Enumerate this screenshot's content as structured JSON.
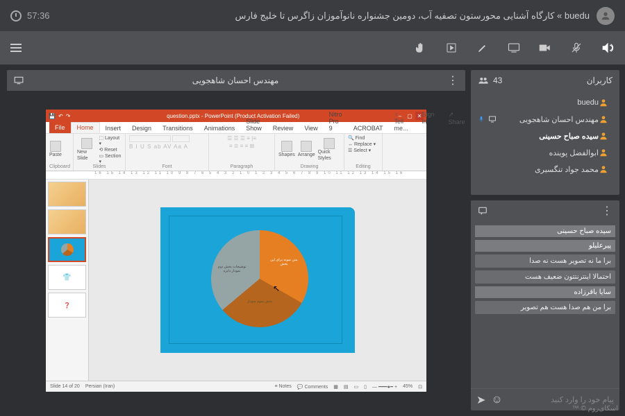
{
  "header": {
    "title": "buedu » کارگاه آشنایی محورستون تصفیه آب، دومین جشنواره نانوآموزان زاگرس تا خلیج فارس",
    "timer": "57:36"
  },
  "presentation": {
    "presenter_name": "مهندس احسان شاهجویی"
  },
  "users": {
    "panel_title": "کاربران",
    "count": "43",
    "list": [
      {
        "name": "buedu",
        "bold": false
      },
      {
        "name": "مهندس احسان شاهجویی",
        "bold": false,
        "mic": true,
        "screen": true
      },
      {
        "name": "سیده صباح حسینی",
        "bold": true
      },
      {
        "name": "ابوالفضل پوینده",
        "bold": false
      },
      {
        "name": "محمد جواد تنگسیری",
        "bold": false
      }
    ]
  },
  "chat": {
    "messages": [
      {
        "name": "سیده صباح حسینی",
        "text": ""
      },
      {
        "name": "پیرعلیلو",
        "text": "برا ما نه تصویر هست نه صدا"
      },
      {
        "name": "",
        "text": "احتمالا اینترنتتون ضعیف هست"
      },
      {
        "name": "سایا باقرزاده",
        "text": "برا من هم صدا هست هم تصویر"
      }
    ],
    "placeholder": "پیام خود را وارد کنید"
  },
  "powerpoint": {
    "title": "question.pptx - PowerPoint (Product Activation Failed)",
    "tabs": [
      "File",
      "Home",
      "Insert",
      "Design",
      "Transitions",
      "Animations",
      "Slide Show",
      "Review",
      "View",
      "Nitro Pro 9",
      "ACROBAT"
    ],
    "tell_me": "♀ Tell me...",
    "sign_in": "Sign in",
    "share": "↗ Share",
    "groups": {
      "clipboard": "Clipboard",
      "slides": "Slides",
      "font": "Font",
      "paragraph": "Paragraph",
      "drawing": "Drawing",
      "editing": "Editing",
      "paste": "Paste",
      "new_slide": "New Slide",
      "layout": "⬚ Layout ▾",
      "reset": "⟲ Reset",
      "section": "▭ Section ▾",
      "shapes": "Shapes",
      "arrange": "Arrange",
      "quick_styles": "Quick Styles",
      "find": "🔍 Find",
      "replace": "↔ Replace ▾",
      "select": "☰ Select ▾"
    },
    "status_left": "Slide 14 of 20",
    "status_lang": "Persian (Iran)",
    "status_notes": "≡ Notes",
    "status_comments": "💬 Comments",
    "zoom": "45%"
  },
  "chart_data": {
    "type": "pie",
    "title": "",
    "series": [
      {
        "name": "slice-orange",
        "value": 33,
        "color": "#e67e22"
      },
      {
        "name": "slice-brown",
        "value": 31,
        "color": "#b5651d"
      },
      {
        "name": "slice-gray",
        "value": 36,
        "color": "#95a5a6"
      }
    ]
  },
  "footer": "اسکای‌روم © ™"
}
